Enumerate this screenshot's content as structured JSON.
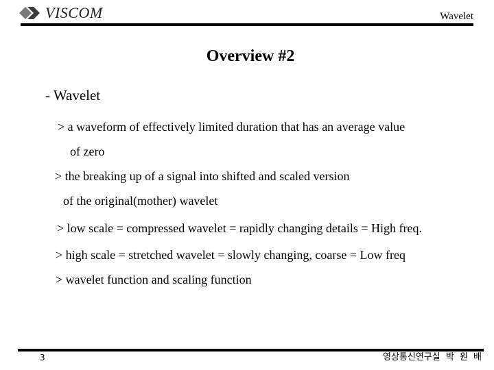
{
  "header": {
    "logo_text": "VISCOM",
    "logo_icon": "double-diamond-arrow-icon",
    "section_label": "Wavelet"
  },
  "slide": {
    "title": "Overview #2",
    "heading": "- Wavelet",
    "lines": [
      "> a waveform of effectively limited duration that has an average value",
      "of zero",
      "> the breaking up of a signal into shifted and scaled version",
      "of the original(mother) wavelet",
      "> low scale = compressed wavelet = rapidly changing details = High freq.",
      "> high scale = stretched wavelet = slowly changing, coarse = Low freq",
      "> wavelet function and scaling function"
    ]
  },
  "footer": {
    "page_number": "3",
    "author": "영상통신연구실 박 원 배"
  }
}
